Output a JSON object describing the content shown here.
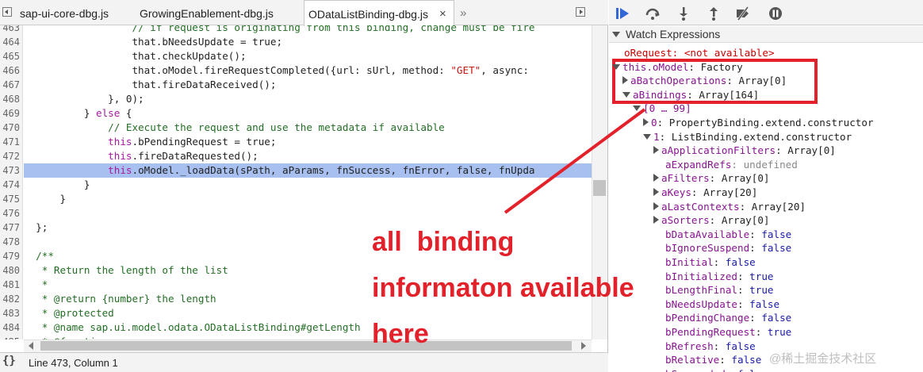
{
  "tabs": {
    "items": [
      {
        "label": "sap-ui-core-dbg.js"
      },
      {
        "label": "GrowingEnablement-dbg.js"
      },
      {
        "label": "ODataListBinding-dbg.js",
        "close": "×"
      }
    ],
    "more": "»"
  },
  "code": {
    "lines": [
      {
        "n": "463",
        "t": [
          [
            "                  ",
            ""
          ],
          [
            "// if request is originating from this binding, change must be fire",
            "cm"
          ]
        ]
      },
      {
        "n": "464",
        "t": [
          [
            "                  that.bNeedsUpdate = true;",
            ""
          ]
        ]
      },
      {
        "n": "465",
        "t": [
          [
            "                  that.checkUpdate();",
            ""
          ]
        ]
      },
      {
        "n": "466",
        "t": [
          [
            "                  that.oModel.fireRequestCompleted({url: sUrl, method: ",
            ""
          ],
          [
            "\"GET\"",
            "str"
          ],
          [
            ", async: ",
            ""
          ]
        ]
      },
      {
        "n": "467",
        "t": [
          [
            "                  that.fireDataReceived();",
            ""
          ]
        ]
      },
      {
        "n": "468",
        "t": [
          [
            "              }, 0);",
            ""
          ]
        ]
      },
      {
        "n": "469",
        "t": [
          [
            "          } ",
            ""
          ],
          [
            "else",
            "kw"
          ],
          [
            " {",
            ""
          ]
        ]
      },
      {
        "n": "470",
        "t": [
          [
            "              ",
            ""
          ],
          [
            "// Execute the request and use the metadata if available",
            "cm"
          ]
        ]
      },
      {
        "n": "471",
        "t": [
          [
            "              ",
            ""
          ],
          [
            "this",
            "kw"
          ],
          [
            ".bPendingRequest = true;",
            ""
          ]
        ]
      },
      {
        "n": "472",
        "t": [
          [
            "              ",
            ""
          ],
          [
            "this",
            "kw"
          ],
          [
            ".fireDataRequested();",
            ""
          ]
        ]
      },
      {
        "n": "473",
        "t": [
          [
            "              ",
            ""
          ],
          [
            "this",
            "kw"
          ],
          [
            ".oModel._loadData(sPath, aParams, fnSuccess, fnError, false, fnUpda",
            ""
          ]
        ],
        "hl": true
      },
      {
        "n": "474",
        "t": [
          [
            "          }",
            ""
          ]
        ]
      },
      {
        "n": "475",
        "t": [
          [
            "      }",
            ""
          ]
        ]
      },
      {
        "n": "476",
        "t": [
          [
            "",
            ""
          ]
        ]
      },
      {
        "n": "477",
        "t": [
          [
            "  };",
            ""
          ]
        ]
      },
      {
        "n": "478",
        "t": [
          [
            "",
            ""
          ]
        ]
      },
      {
        "n": "479",
        "t": [
          [
            "  ",
            ""
          ],
          [
            "/**",
            "cm"
          ]
        ]
      },
      {
        "n": "480",
        "t": [
          [
            "   ",
            ""
          ],
          [
            "* Return the length of the list",
            "cm"
          ]
        ]
      },
      {
        "n": "481",
        "t": [
          [
            "   ",
            ""
          ],
          [
            "*",
            "cm"
          ]
        ]
      },
      {
        "n": "482",
        "t": [
          [
            "   ",
            ""
          ],
          [
            "* @return {number} the length",
            "cm"
          ]
        ]
      },
      {
        "n": "483",
        "t": [
          [
            "   ",
            ""
          ],
          [
            "* @protected",
            "cm"
          ]
        ]
      },
      {
        "n": "484",
        "t": [
          [
            "   ",
            ""
          ],
          [
            "* @name sap.ui.model.odata.ODataListBinding#getLength",
            "cm"
          ]
        ]
      },
      {
        "n": "485",
        "t": [
          [
            "   ",
            ""
          ],
          [
            "* @function",
            "cm"
          ]
        ]
      }
    ]
  },
  "status": {
    "braces": "{}",
    "text": "Line 473, Column 1"
  },
  "debugger": {
    "toolbar": [
      "resume-icon",
      "step-over-icon",
      "step-into-icon",
      "step-out-icon",
      "deactivate-breakpoints-icon",
      "pause-on-exceptions-icon"
    ],
    "watch_title": "Watch Expressions"
  },
  "watch": {
    "rows": [
      {
        "indent": 0,
        "tri": "",
        "parts": [
          [
            "oRequest: <not available>",
            "err"
          ]
        ]
      },
      {
        "indent": 0,
        "tri": "d",
        "parts": [
          [
            "this.oModel",
            "prop"
          ],
          [
            ": Factory",
            ""
          ]
        ]
      },
      {
        "indent": 1,
        "tri": "r",
        "parts": [
          [
            "aBatchOperations",
            "prop"
          ],
          [
            ": Array[0]",
            ""
          ]
        ]
      },
      {
        "indent": 1,
        "tri": "d",
        "parts": [
          [
            "aBindings",
            "prop"
          ],
          [
            ": Array[164]",
            ""
          ]
        ]
      },
      {
        "indent": 2,
        "tri": "d",
        "parts": [
          [
            "[0 … 99]",
            "prop"
          ]
        ]
      },
      {
        "indent": 3,
        "tri": "r",
        "parts": [
          [
            "0",
            "prop"
          ],
          [
            ": PropertyBinding.extend.constructor",
            ""
          ]
        ]
      },
      {
        "indent": 3,
        "tri": "d",
        "parts": [
          [
            "1",
            "prop"
          ],
          [
            ": ListBinding.extend.constructor",
            ""
          ]
        ]
      },
      {
        "indent": 4,
        "tri": "r",
        "parts": [
          [
            "aApplicationFilters",
            "prop"
          ],
          [
            ": Array[0]",
            ""
          ]
        ]
      },
      {
        "indent": 4,
        "tri": "",
        "parts": [
          [
            "aExpandRefs",
            "prop"
          ],
          [
            ": undefined",
            "dim"
          ]
        ]
      },
      {
        "indent": 4,
        "tri": "r",
        "parts": [
          [
            "aFilters",
            "prop"
          ],
          [
            ": Array[0]",
            ""
          ]
        ]
      },
      {
        "indent": 4,
        "tri": "r",
        "parts": [
          [
            "aKeys",
            "prop"
          ],
          [
            ": Array[20]",
            ""
          ]
        ]
      },
      {
        "indent": 4,
        "tri": "r",
        "parts": [
          [
            "aLastContexts",
            "prop"
          ],
          [
            ": Array[20]",
            ""
          ]
        ]
      },
      {
        "indent": 4,
        "tri": "r",
        "parts": [
          [
            "aSorters",
            "prop"
          ],
          [
            ": Array[0]",
            ""
          ]
        ]
      },
      {
        "indent": 4,
        "tri": "",
        "parts": [
          [
            "bDataAvailable",
            "prop"
          ],
          [
            ": ",
            ""
          ],
          [
            "false",
            "bool"
          ]
        ]
      },
      {
        "indent": 4,
        "tri": "",
        "parts": [
          [
            "bIgnoreSuspend",
            "prop"
          ],
          [
            ": ",
            ""
          ],
          [
            "false",
            "bool"
          ]
        ]
      },
      {
        "indent": 4,
        "tri": "",
        "parts": [
          [
            "bInitial",
            "prop"
          ],
          [
            ": ",
            ""
          ],
          [
            "false",
            "bool"
          ]
        ]
      },
      {
        "indent": 4,
        "tri": "",
        "parts": [
          [
            "bInitialized",
            "prop"
          ],
          [
            ": ",
            ""
          ],
          [
            "true",
            "bool"
          ]
        ]
      },
      {
        "indent": 4,
        "tri": "",
        "parts": [
          [
            "bLengthFinal",
            "prop"
          ],
          [
            ": ",
            ""
          ],
          [
            "true",
            "bool"
          ]
        ]
      },
      {
        "indent": 4,
        "tri": "",
        "parts": [
          [
            "bNeedsUpdate",
            "prop"
          ],
          [
            ": ",
            ""
          ],
          [
            "false",
            "bool"
          ]
        ]
      },
      {
        "indent": 4,
        "tri": "",
        "parts": [
          [
            "bPendingChange",
            "prop"
          ],
          [
            ": ",
            ""
          ],
          [
            "false",
            "bool"
          ]
        ]
      },
      {
        "indent": 4,
        "tri": "",
        "parts": [
          [
            "bPendingRequest",
            "prop"
          ],
          [
            ": ",
            ""
          ],
          [
            "true",
            "bool"
          ]
        ]
      },
      {
        "indent": 4,
        "tri": "",
        "parts": [
          [
            "bRefresh",
            "prop"
          ],
          [
            ": ",
            ""
          ],
          [
            "false",
            "bool"
          ]
        ]
      },
      {
        "indent": 4,
        "tri": "",
        "parts": [
          [
            "bRelative",
            "prop"
          ],
          [
            ": ",
            ""
          ],
          [
            "false",
            "bool"
          ]
        ]
      },
      {
        "indent": 4,
        "tri": "",
        "parts": [
          [
            "bSuspended",
            "prop"
          ],
          [
            ": ",
            ""
          ],
          [
            "false",
            "bool"
          ]
        ]
      }
    ]
  },
  "annotation": {
    "line1": "all  binding",
    "line2": "informaton available",
    "line3": "here",
    "color": "#e3212a"
  },
  "watermark": "@稀土掘金技术社区"
}
